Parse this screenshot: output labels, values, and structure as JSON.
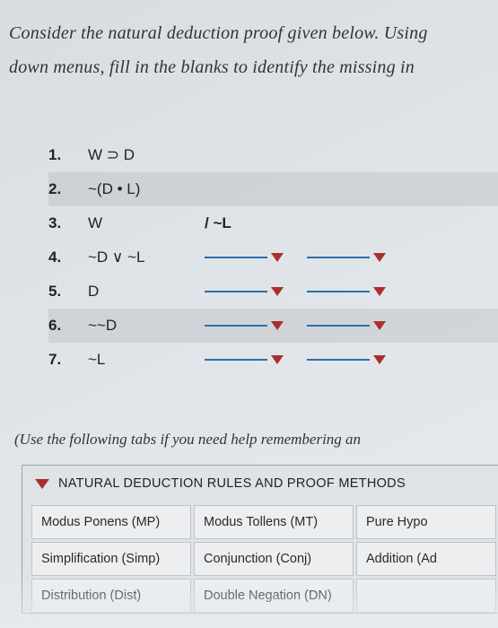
{
  "instructions": {
    "line1": "Consider the natural deduction proof given below. Using",
    "line2": "down menus, fill in the blanks to identify the missing in"
  },
  "proof": {
    "rows": [
      {
        "num": "1.",
        "formula": "W ⊃ D",
        "just_text": "",
        "has_dropdowns": false,
        "shaded": false
      },
      {
        "num": "2.",
        "formula": "~(D • L)",
        "just_text": "",
        "has_dropdowns": false,
        "shaded": true
      },
      {
        "num": "3.",
        "formula": "W",
        "just_text": "/ ~L",
        "has_dropdowns": false,
        "shaded": false
      },
      {
        "num": "4.",
        "formula": "~D ∨ ~L",
        "just_text": "",
        "has_dropdowns": true,
        "shaded": false
      },
      {
        "num": "5.",
        "formula": "D",
        "just_text": "",
        "has_dropdowns": true,
        "shaded": false
      },
      {
        "num": "6.",
        "formula": "~~D",
        "just_text": "",
        "has_dropdowns": true,
        "shaded": true
      },
      {
        "num": "7.",
        "formula": "~L",
        "just_text": "",
        "has_dropdowns": true,
        "shaded": false
      }
    ]
  },
  "help_note": "(Use the following tabs if you need help remembering an",
  "rules_panel": {
    "header": "NATURAL DEDUCTION RULES AND PROOF METHODS",
    "cells": [
      "Modus Ponens (MP)",
      "Modus Tollens (MT)",
      "Pure Hypo",
      "Simplification (Simp)",
      "Conjunction (Conj)",
      "Addition (Ad",
      "Distribution (Dist)",
      "Double Negation (DN)",
      ""
    ]
  }
}
